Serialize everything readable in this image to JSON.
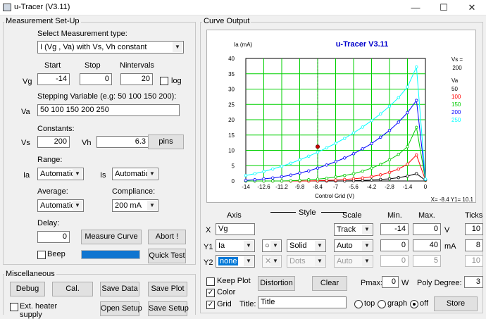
{
  "window": {
    "title": "u-Tracer (V3.11)",
    "minimize": "—",
    "maximize": "☐",
    "close": "✕"
  },
  "setup": {
    "group_title": "Measurement Set-Up",
    "type_label": "Select Measurement type:",
    "type_value": "I (Vg , Va) with Vs, Vh constant",
    "start_label": "Start",
    "stop_label": "Stop",
    "nintervals_label": "Nintervals",
    "vg_label": "Vg",
    "vg_start": "-14",
    "vg_stop": "0",
    "vg_nint": "20",
    "log_label": "log",
    "stepping_label": "Stepping Variable (e.g: 50 100 150 200):",
    "va_label": "Va",
    "va_value": "50 100 150 200 250",
    "constants_label": "Constants:",
    "vs_label": "Vs",
    "vs_value": "200",
    "vh_label": "Vh",
    "vh_value": "6.3",
    "pins_label": "pins",
    "range_label": "Range:",
    "ia_label": "Ia",
    "ia_range": "Automatic",
    "is_label": "Is",
    "is_range": "Automatic",
    "average_label": "Average:",
    "average_value": "Automatic",
    "compliance_label": "Compliance:",
    "compliance_value": "200 mA",
    "delay_label": "Delay:",
    "delay_value": "0",
    "measure_label": "Measure Curve",
    "abort_label": "Abort !",
    "beep_label": "Beep",
    "quicktest_label": "Quick Test",
    "progress": 1.0
  },
  "misc": {
    "group_title": "Miscellaneous",
    "debug": "Debug",
    "cal": "Cal.",
    "save_data": "Save Data",
    "save_plot": "Save Plot",
    "ext_heater": "Ext. heater supply",
    "open_setup": "Open Setup",
    "save_setup": "Save Setup"
  },
  "curve": {
    "group_title": "Curve Output",
    "axis_header": "Axis",
    "style_header": "Style",
    "scale_header": "Scale",
    "min_header": "Min.",
    "max_header": "Max.",
    "ticks_header": "Ticks",
    "x_label": "X",
    "x_var": "Vg",
    "x_scale": "Track",
    "x_min": "-14",
    "x_max": "0",
    "x_unit": "V",
    "x_ticks": "10",
    "y1_label": "Y1",
    "y1_var": "Ia",
    "y1_marker": "○",
    "y1_line": "Solid",
    "y1_scale": "Auto",
    "y1_min": "0",
    "y1_max": "40",
    "y1_unit": "mA",
    "y1_ticks": "8",
    "y2_label": "Y2",
    "y2_var": "none",
    "y2_marker": "✕",
    "y2_line": "Dots",
    "y2_scale": "Auto",
    "y2_min": "0",
    "y2_max": "5",
    "y2_ticks": "10",
    "keep_plot": "Keep Plot",
    "color": "Color",
    "grid": "Grid",
    "distortion": "Distortion",
    "clear": "Clear",
    "pmax_label": "Pmax:",
    "pmax_value": "0",
    "pmax_unit": "W",
    "poly_label": "Poly Degree:",
    "poly_value": "3",
    "title_label": "Title:",
    "title_value": "Title",
    "top_label": "top",
    "graph_label": "graph",
    "off_label": "off",
    "store_label": "Store"
  },
  "chart_data": {
    "type": "line",
    "title": "u-Tracer V3.11",
    "xlabel": "Control Grid (V)",
    "ylabel": "Ia (mA)",
    "xlim": [
      -14,
      0
    ],
    "ylim": [
      0,
      40
    ],
    "xticks": [
      "-14",
      "-12.6",
      "-11.2",
      "-9.8",
      "-8.4",
      "-7",
      "-5.6",
      "-4.2",
      "-2.8",
      "-1.4",
      "0"
    ],
    "yticks": [
      "0",
      "5",
      "10",
      "15",
      "20",
      "25",
      "30",
      "35",
      "40"
    ],
    "grid": true,
    "legend_title": "Va",
    "legend_vs_label": "Vs =",
    "legend_vs_value": "200",
    "x": [
      -14,
      -13.3,
      -12.6,
      -11.9,
      -11.2,
      -10.5,
      -9.8,
      -9.1,
      -8.4,
      -7.7,
      -7,
      -6.3,
      -5.6,
      -4.9,
      -4.2,
      -3.5,
      -2.8,
      -2.1,
      -1.4,
      -0.7,
      0
    ],
    "series": [
      {
        "name": "50",
        "color": "#000000",
        "values": [
          0,
          0,
          0,
          0,
          0,
          0,
          0,
          0,
          0,
          0,
          0,
          0,
          0.1,
          0.2,
          0.3,
          0.5,
          0.7,
          1.1,
          1.6,
          2.4,
          0.2
        ]
      },
      {
        "name": "100",
        "color": "#ff0000",
        "values": [
          0,
          0,
          0,
          0,
          0,
          0,
          0,
          0,
          0.1,
          0.2,
          0.3,
          0.5,
          0.7,
          1.0,
          1.4,
          2.0,
          2.8,
          3.9,
          5.5,
          8.5,
          0.3
        ]
      },
      {
        "name": "150",
        "color": "#00cc00",
        "values": [
          0,
          0,
          0,
          0,
          0,
          0.1,
          0.2,
          0.4,
          0.6,
          0.9,
          1.3,
          1.8,
          2.4,
          3.2,
          4.2,
          5.4,
          6.9,
          8.7,
          11.2,
          17.5,
          0.4
        ]
      },
      {
        "name": "200",
        "color": "#0000ff",
        "values": [
          0.2,
          0.4,
          0.7,
          1.0,
          1.4,
          1.9,
          2.6,
          3.3,
          4.2,
          5.2,
          6.3,
          7.5,
          8.9,
          10.5,
          12.2,
          14.3,
          16.5,
          19.2,
          22.3,
          26.3,
          0.5
        ]
      },
      {
        "name": "250",
        "color": "#00ffff",
        "values": [
          1.8,
          2.4,
          3.1,
          3.9,
          4.8,
          5.8,
          6.9,
          8.1,
          9.4,
          10.8,
          12.3,
          13.9,
          15.7,
          17.6,
          19.7,
          21.9,
          24.4,
          27.2,
          30.7,
          37.2,
          0.6
        ]
      }
    ],
    "highlight": {
      "x": -8.4,
      "y": 11.2
    },
    "cursor_readout": "X= -8.4   Y1= 10.1"
  }
}
